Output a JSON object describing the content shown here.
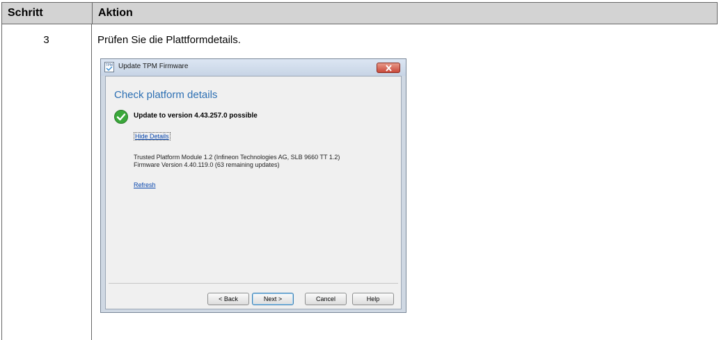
{
  "table": {
    "header_step": "Schritt",
    "header_action": "Aktion",
    "row": {
      "step": "3",
      "action": "Prüfen Sie die Plattformdetails."
    }
  },
  "dialog": {
    "title": "Update TPM Firmware",
    "icon": "tpm-icon",
    "heading": "Check platform details",
    "status": "Update to version 4.43.257.0 possible",
    "hide_details": "Hide Details",
    "info_line1": "Trusted Platform Module 1.2 (Infineon Technologies AG, SLB 9660 TT 1.2)",
    "info_line2": "Firmware Version 4.40.119.0 (63 remaining updates)",
    "refresh": "Refresh",
    "buttons": {
      "back": "< Back",
      "next": "Next >",
      "cancel": "Cancel",
      "help": "Help"
    }
  },
  "colors": {
    "heading": "#2c6fb3",
    "link": "#0645ad",
    "success": "#3aa83a",
    "header_bg": "#d3d3d3"
  }
}
